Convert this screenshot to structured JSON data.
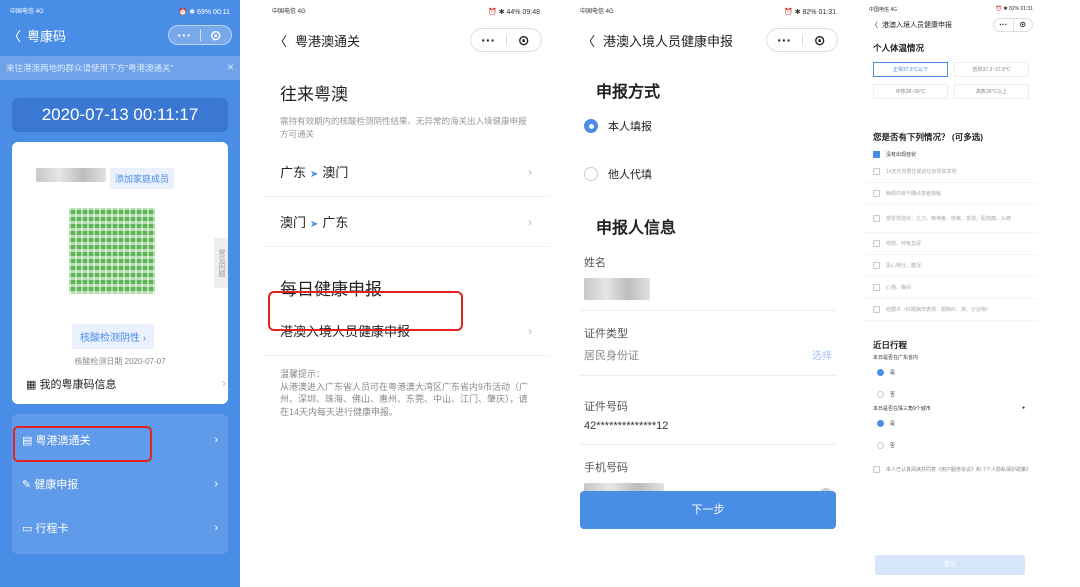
{
  "p1": {
    "status_left": "中国电信 4G",
    "status_right": "⏰ ✱ 69% 00:11",
    "back": "〈",
    "title": "粤康码",
    "notice": "来往港澳两地的群众请使用下方\"粤港澳通关\"",
    "notice_close": "✕",
    "datetime": "2020-07-13 00:11:17",
    "add_family": "添加家庭成员",
    "faq": "常见问题",
    "nat_btn": "核酸检测阴性 ›",
    "nat_date": "核酸检测日期 2020-07-07",
    "my_info": "我的粤康码信息",
    "menu": [
      {
        "label": "粤港澳通关",
        "icon": "▤"
      },
      {
        "label": "健康申报",
        "icon": "✎"
      },
      {
        "label": "行程卡",
        "icon": "▭"
      }
    ]
  },
  "p2": {
    "status_left": "中国电信 4G",
    "status_right": "⏰ ✱ 44% 09:48",
    "back": "〈",
    "title": "粤港澳通关",
    "h1": "往来粤澳",
    "desc": "需持有效期内的核酸检测阴性结果、无异常的海关出入境健康申报方可通关",
    "route1_from": "广东",
    "route1_to": "澳门",
    "route2_from": "澳门",
    "route2_to": "广东",
    "h2": "每日健康申报",
    "declare": "港澳入境人员健康申报",
    "tip": "温馨提示：\n从港澳进入广东省人员可在粤港澳大湾区广东省内9市活动（广州、深圳、珠海、佛山、惠州、东莞、中山、江门、肇庆），请在14天内每天进行健康申报。"
  },
  "p3": {
    "status_left": "中国电信 4G",
    "status_right": "⏰ ✱ 82% 01:31",
    "back": "〈",
    "title": "港澳入境人员健康申报",
    "h_method": "申报方式",
    "opt_self": "本人填报",
    "opt_other": "他人代填",
    "h_info": "申报人信息",
    "name_label": "姓名",
    "idtype_label": "证件类型",
    "idtype_value": "居民身份证",
    "choose": "选择",
    "idno_label": "证件号码",
    "idno_value": "42**************12",
    "phone_label": "手机号码",
    "next": "下一步"
  },
  "p4": {
    "status_left": "中国电信 4G",
    "status_right": "⏰ ✱ 82% 01:31",
    "back": "〈",
    "title": "港澳入境人员健康申报",
    "h_temp": "个人体温情况",
    "temps": [
      "正常37.3°C以下",
      "低热37.3~37.9°C",
      "中热38~39°C",
      "高热39°C以上"
    ],
    "h_symptoms": "您是否有下列情况？ (可多选)",
    "symptoms": [
      "没有出现症状",
      "14天内曾居住或前往疫情高发地",
      "两周内有与确诊患者接触",
      "感冒样症状：乏力、精神差、咳嗽、发烧、肌肉痛、头痛",
      "喘憋、呼吸急促",
      "恶心呕吐、腹泻",
      "心慌、胸闷",
      "结膜炎（红眼病样表现：眼睛红、痒、分泌物）"
    ],
    "h_trip": "近日行程",
    "q1": "本日是否在广东省内",
    "q2": "本日是否在珠三角9个城市",
    "yes": "是",
    "no": "否",
    "agree": "本人已认真阅读并同意《用户服务协议》和《个人隐私保护政策》",
    "submit": "提交"
  }
}
